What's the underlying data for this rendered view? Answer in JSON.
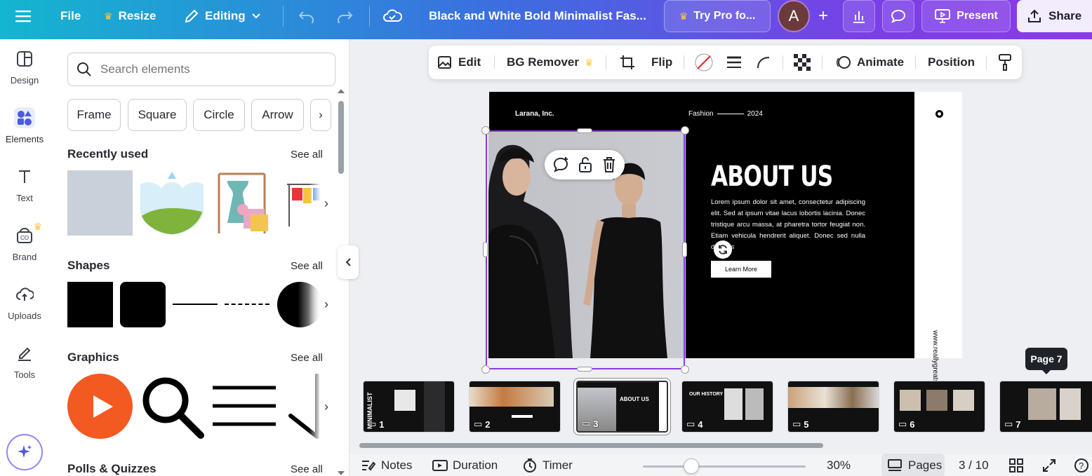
{
  "topbar": {
    "file_label": "File",
    "resize_label": "Resize",
    "editing_label": "Editing",
    "doc_title": "Black and White Bold Minimalist Fas...",
    "try_pro_label": "Try Pro fo...",
    "avatar_letter": "A",
    "present_label": "Present",
    "share_label": "Share"
  },
  "rail": {
    "items": [
      {
        "label": "Design",
        "icon": "design-icon"
      },
      {
        "label": "Elements",
        "icon": "elements-icon"
      },
      {
        "label": "Text",
        "icon": "text-icon"
      },
      {
        "label": "Brand",
        "icon": "brand-icon"
      },
      {
        "label": "Uploads",
        "icon": "uploads-icon"
      },
      {
        "label": "Tools",
        "icon": "tools-icon"
      }
    ]
  },
  "panel": {
    "search_placeholder": "Search elements",
    "chips": [
      "Frame",
      "Square",
      "Circle",
      "Arrow"
    ],
    "sections": {
      "recent": "Recently used",
      "shapes": "Shapes",
      "graphics": "Graphics",
      "polls": "Polls & Quizzes"
    },
    "see_all": "See all"
  },
  "context_toolbar": {
    "edit": "Edit",
    "bg_remover": "BG Remover",
    "flip": "Flip",
    "animate": "Animate",
    "position": "Position"
  },
  "slide": {
    "company": "Larana, Inc.",
    "fashion": "Fashion",
    "year": "2024",
    "title": "ABOUT US",
    "body": "Lorem ipsum dolor sit amet, consectetur adipiscing elit. Sed at ipsum vitae lacus lobortis lacinia. Donec tristique arcu massa, at pharetra tortor feugiat non. Etiam vehicula hendrerit aliquet. Donec sed nulla dapibus",
    "button": "Learn More",
    "website": "www.reallygreatsite.com"
  },
  "thumbnails": [
    {
      "num": "1"
    },
    {
      "num": "2"
    },
    {
      "num": "3"
    },
    {
      "num": "4"
    },
    {
      "num": "5"
    },
    {
      "num": "6"
    },
    {
      "num": "7"
    }
  ],
  "tooltip": "Page 7",
  "bottombar": {
    "notes": "Notes",
    "duration": "Duration",
    "timer": "Timer",
    "zoom": "30%",
    "pages": "Pages",
    "page_counter": "3 / 10"
  },
  "colors": {
    "accent": "#8b3be8",
    "gradient_start": "#13b6cf",
    "gradient_end": "#8b3be8",
    "crown": "#ffc83d"
  }
}
